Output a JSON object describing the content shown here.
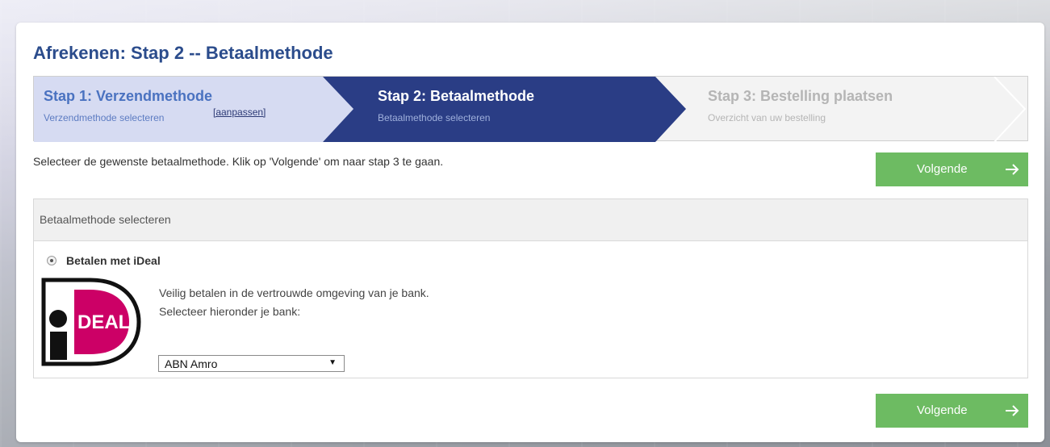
{
  "page": {
    "title": "Afrekenen: Stap 2 -- Betaalmethode"
  },
  "steps": [
    {
      "title": "Stap 1: Verzendmethode",
      "subtitle": "Verzendmethode selecteren",
      "edit_link": "[aanpassen]",
      "state": "completed"
    },
    {
      "title": "Stap 2: Betaalmethode",
      "subtitle": "Betaalmethode selecteren",
      "state": "active"
    },
    {
      "title": "Stap 3: Bestelling plaatsen",
      "subtitle": "Overzicht van uw bestelling",
      "state": "upcoming"
    }
  ],
  "instruction": "Selecteer de gewenste betaalmethode. Klik op 'Volgende' om naar stap 3 te gaan.",
  "buttons": {
    "next_label": "Volgende",
    "next_icon": "arrow-right-icon"
  },
  "panel": {
    "header": "Betaalmethode selecteren",
    "option": {
      "label": "Betalen met iDeal",
      "selected": true,
      "logo_text": "DEAL",
      "description_line1": "Veilig betalen in de vertrouwde omgeving van je bank.",
      "description_line2": "Selecteer hieronder je bank:",
      "bank_selected": "ABN Amro"
    }
  },
  "colors": {
    "title": "#2b4c8c",
    "step_completed_bg": "#d6dbf2",
    "step_active_bg": "#2a3d85",
    "step_upcoming_bg": "#f3f3f3",
    "button": "#6dbb62",
    "ideal_pink": "#cc0066"
  }
}
